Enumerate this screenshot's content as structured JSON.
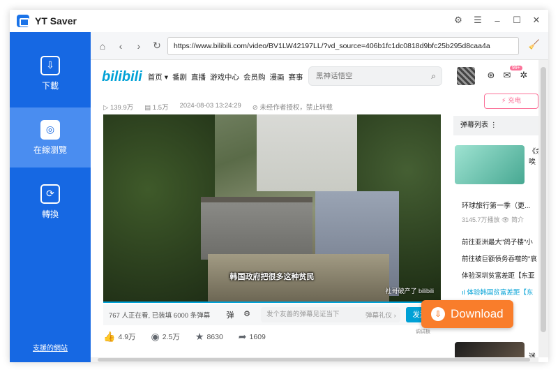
{
  "app": {
    "title": "YT Saver"
  },
  "window": {
    "settings_icon": "⚙",
    "menu_icon": "☰",
    "min_icon": "–",
    "max_icon": "☐",
    "close_icon": "✕"
  },
  "sidebar": {
    "items": [
      {
        "label": "下載",
        "icon": "⇩"
      },
      {
        "label": "在線瀏覽",
        "icon": "◎"
      },
      {
        "label": "轉換",
        "icon": "⟳"
      }
    ],
    "supported_sites": "支援的網站"
  },
  "browser": {
    "url": "https://www.bilibili.com/video/BV1LW42197LL/?vd_source=406b1fc1dc0818d9bfc25b295d8caa4a",
    "home_icon": "⌂",
    "back_icon": "‹",
    "forward_icon": "›",
    "refresh_icon": "↻",
    "clean_icon": "🧹"
  },
  "bili": {
    "logo": "bilibili",
    "nav": [
      "首页 ▾",
      "番剧",
      "直播",
      "游戏中心",
      "会员购",
      "漫画",
      "赛事"
    ],
    "search_placeholder": "黑神话悟空",
    "badge": "99+",
    "stats": {
      "views": "139.9万",
      "danmaku": "1.5万",
      "date": "2024-08-03 13:24:29",
      "notice": "未经作者授权，禁止转载"
    },
    "subtitle": "韩国政府把很多这种贫民",
    "watermark": "社哥破产了 bilibili",
    "danmaku_bar": {
      "watching": "767 人正在看, 已装填 6000 条弹幕",
      "placeholder": "发个友善的弹幕见证当下",
      "etiquette": "弹幕礼仪 ›",
      "send": "发送"
    },
    "actions": {
      "likes": "4.9万",
      "coins": "2.5万",
      "favorites": "8630",
      "shares": "1609"
    },
    "right": {
      "charge": "⚡ 充电",
      "danmaku_list": "弹幕列表  ⋮",
      "rec_side": "《余\n唉",
      "rec_title": "环球旅行第一季（更...",
      "rec_meta": "3145.7万播放  👁 简介",
      "episodes": [
        {
          "text": "前往亚洲最大\"鸽子楼\"小",
          "active": false
        },
        {
          "text": "前往被巨额债务吞噬的\"哀",
          "active": false
        },
        {
          "text": "体验深圳贫富差距【东亚",
          "active": false
        },
        {
          "text": "ıl 体验韩国贫富差距【东",
          "active": true
        }
      ],
      "rec_side2": "迷"
    }
  },
  "download": {
    "label": "Download",
    "icon": "⇩",
    "tag": "调试板"
  }
}
